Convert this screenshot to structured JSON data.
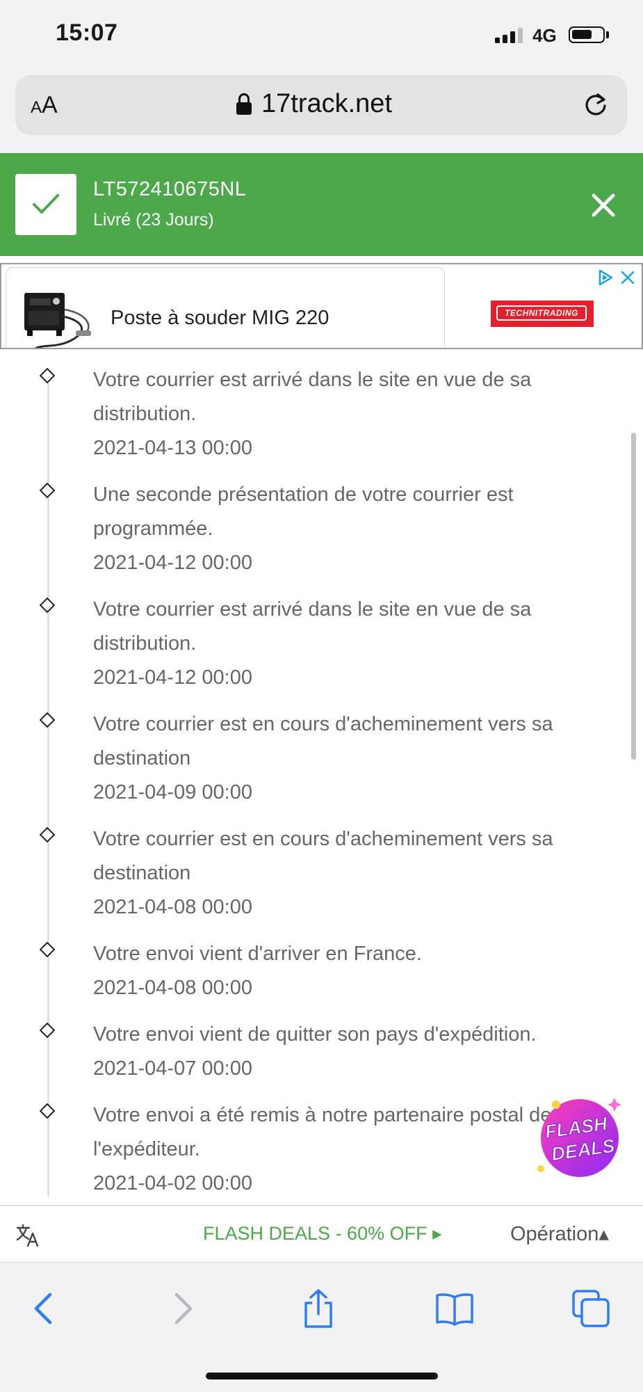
{
  "status_bar": {
    "time": "15:07",
    "network": "4G"
  },
  "browser": {
    "reader_label": "AA",
    "url": "17track.net"
  },
  "tracking": {
    "number": "LT572410675NL",
    "status": "Livré (23 Jours)"
  },
  "ad": {
    "title": "Poste à souder MIG 220",
    "brand": "TECHNITRADING"
  },
  "events": [
    {
      "text": "Votre courrier est arrivé dans le site en vue de sa distribution.",
      "date": "2021-04-13 00:00"
    },
    {
      "text": "Une seconde présentation de votre courrier est programmée.",
      "date": "2021-04-12 00:00"
    },
    {
      "text": "Votre courrier est arrivé dans le site en vue de sa distribution.",
      "date": "2021-04-12 00:00"
    },
    {
      "text": "Votre courrier est en cours d'acheminement vers sa destination",
      "date": "2021-04-09 00:00"
    },
    {
      "text": "Votre courrier est en cours d'acheminement vers sa destination",
      "date": "2021-04-08 00:00"
    },
    {
      "text": "Votre envoi vient d'arriver en France.",
      "date": "2021-04-08 00:00"
    },
    {
      "text": "Votre envoi vient de quitter son pays d'expédition.",
      "date": "2021-04-07 00:00"
    },
    {
      "text": "Votre envoi a été remis à notre partenaire postal de l'expéditeur.",
      "date": "2021-04-02 00:00"
    }
  ],
  "flash_badge": {
    "line1": "FLASH",
    "line2": "DEALS"
  },
  "footer": {
    "flash_link": "FLASH DEALS - 60% OFF ▸",
    "operation": "Opération▴"
  },
  "colors": {
    "accent_green": "#4ca84a",
    "ad_red": "#e3202b",
    "ios_blue": "#2f7cf6"
  },
  "icons": [
    "signal-icon",
    "battery-icon",
    "lock-icon",
    "reload-icon",
    "check-icon",
    "close-icon",
    "ad-choices-icon",
    "translate-icon",
    "back-icon",
    "forward-icon",
    "share-icon",
    "bookmarks-icon",
    "tabs-icon"
  ]
}
